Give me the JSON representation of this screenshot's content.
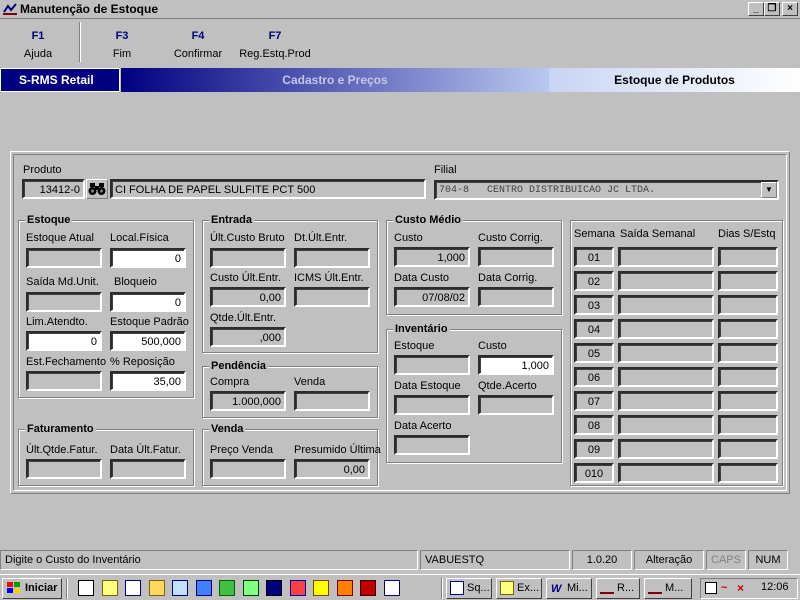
{
  "window": {
    "title": "Manutenção de Estoque"
  },
  "toolbar": [
    {
      "key": "F1",
      "label": "Ajuda"
    },
    {
      "key": "F3",
      "label": "Fim"
    },
    {
      "key": "F4",
      "label": "Confirmar"
    },
    {
      "key": "F7",
      "label": "Reg.Estq.Prod"
    }
  ],
  "band": {
    "left": "S-RMS Retail",
    "middle": "Cadastro e Preços",
    "right": "Estoque de Produtos"
  },
  "produto": {
    "label": "Produto",
    "code": "13412-0",
    "description": "CI FOLHA DE PAPEL SULFITE PCT 500"
  },
  "filial": {
    "label": "Filial",
    "value": "704-8   CENTRO DISTRIBUICAO JC LTDA."
  },
  "estoque": {
    "title": "Estoque",
    "estoque_atual": {
      "label": "Estoque Atual",
      "value": ""
    },
    "local_fisica": {
      "label": "Local.Física",
      "value": "0"
    },
    "saida_md_unit": {
      "label": "Saída Md.Unit.",
      "value": ""
    },
    "bloqueio": {
      "label": "Bloqueio",
      "value": "0"
    },
    "lim_atendto": {
      "label": "Lim.Atendto.",
      "value": "0"
    },
    "estoque_padrao": {
      "label": "Estoque Padrão",
      "value": "500,000"
    },
    "est_fechamento": {
      "label": "Est.Fechamento",
      "value": ""
    },
    "pct_reposicao": {
      "label": "% Reposição",
      "value": "35,00"
    }
  },
  "entrada": {
    "title": "Entrada",
    "ult_custo_bruto": {
      "label": "Últ.Custo Bruto",
      "value": ""
    },
    "dt_ult_entr": {
      "label": "Dt.Últ.Entr.",
      "value": ""
    },
    "custo_ult_entr": {
      "label": "Custo Últ.Entr.",
      "value": "0,00"
    },
    "icms_ult_entr": {
      "label": "ICMS Últ.Entr.",
      "value": ""
    },
    "qtde_ult_entr": {
      "label": "Qtde.Últ.Entr.",
      "value": ",000"
    }
  },
  "pendencia": {
    "title": "Pendência",
    "compra": {
      "label": "Compra",
      "value": "1.000,000"
    },
    "venda": {
      "label": "Venda",
      "value": ""
    }
  },
  "venda": {
    "title": "Venda",
    "preco_venda": {
      "label": "Preço Venda",
      "value": ""
    },
    "presumido_ultima": {
      "label": "Presumido Última",
      "value": "0,00"
    }
  },
  "faturamento": {
    "title": "Faturamento",
    "ult_qtde_fatur": {
      "label": "Últ.Qtde.Fatur.",
      "value": ""
    },
    "data_ult_fatur": {
      "label": "Data Últ.Fatur.",
      "value": ""
    }
  },
  "custo_medio": {
    "title": "Custo Médio",
    "custo": {
      "label": "Custo",
      "value": "1,000"
    },
    "custo_corrig": {
      "label": "Custo Corrig.",
      "value": ""
    },
    "data_custo": {
      "label": "Data Custo",
      "value": "07/08/02"
    },
    "data_corrig": {
      "label": "Data Corrig.",
      "value": ""
    }
  },
  "inventario": {
    "title": "Inventário",
    "estoque": {
      "label": "Estoque",
      "value": ""
    },
    "custo": {
      "label": "Custo",
      "value": "1,000"
    },
    "data_estoque": {
      "label": "Data Estoque",
      "value": ""
    },
    "qtde_acerto": {
      "label": "Qtde.Acerto",
      "value": ""
    },
    "data_acerto": {
      "label": "Data Acerto",
      "value": ""
    }
  },
  "semanas": {
    "headers": [
      "Semana",
      "Saída Semanal",
      "Dias S/Estq"
    ],
    "rows": [
      "01",
      "02",
      "03",
      "04",
      "05",
      "06",
      "07",
      "08",
      "09",
      "010"
    ]
  },
  "statusbar": {
    "message": "Digite o Custo do Inventário",
    "program": "VABUESTQ",
    "version": "1.0.20",
    "mode": "Alteração",
    "caps": "CAPS",
    "num": "NUM"
  },
  "taskbar": {
    "start": "Iniciar",
    "tasks": [
      "Sq...",
      "Ex...",
      "Mi...",
      "R...",
      "M..."
    ],
    "clock": "12:06"
  }
}
